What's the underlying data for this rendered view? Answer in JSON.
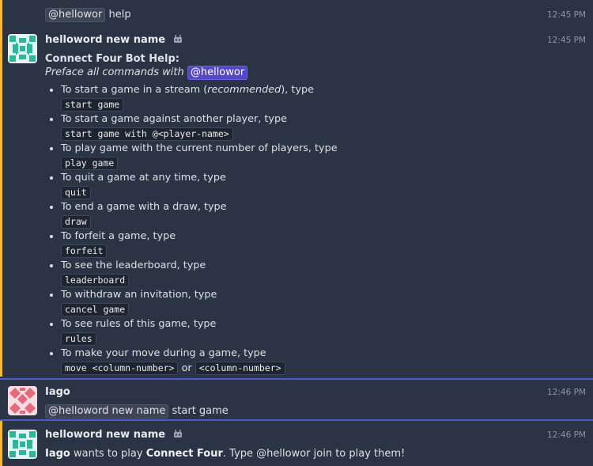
{
  "messages": {
    "m0": {
      "mention": "@hellowor",
      "text": "help",
      "time": "12:45 PM"
    },
    "m1": {
      "sender": "helloword new name",
      "time": "12:45 PM",
      "help_title": "Connect Four Bot Help:",
      "preface": "Preface all commands with",
      "preface_mention": "@hellowor",
      "items": [
        {
          "pre": "To start a game in a stream (",
          "em": "recommended",
          "post": "), type",
          "code": "start game"
        },
        {
          "pre": "To start a game against another player, type",
          "code": "start game with @<player-name>"
        },
        {
          "pre": "To play game with the current number of players, type",
          "code": "play game"
        },
        {
          "pre": "To quit a game at any time, type",
          "code": "quit"
        },
        {
          "pre": "To end a game with a draw, type",
          "code": "draw"
        },
        {
          "pre": "To forfeit a game, type",
          "code": "forfeit"
        },
        {
          "pre": "To see the leaderboard, type",
          "code": "leaderboard"
        },
        {
          "pre": "To withdraw an invitation, type",
          "code": "cancel game"
        },
        {
          "pre": "To see rules of this game, type",
          "code": "rules"
        },
        {
          "pre": "To make your move during a game, type",
          "code": "move <column-number>",
          "mid": "or",
          "code2": "<column-number>"
        }
      ]
    },
    "m2": {
      "sender": "Iago",
      "time": "12:46 PM",
      "mention": "@helloword new name",
      "text": "start game"
    },
    "m3": {
      "sender": "helloword new name",
      "time": "12:46 PM",
      "actor": "Iago",
      "t1": "wants to play",
      "game": "Connect Four",
      "t2": ". Type",
      "mention": "@hellowor",
      "t3": "join to play them!"
    }
  },
  "colors": {
    "background": "#2b3444",
    "bot_bar": "#f2b93b",
    "divider": "#4b5ec0",
    "mention_self": "#5548c8",
    "bot_avatar": "#2fb59a",
    "user_avatar": "#e5697a"
  },
  "icons": {
    "bot": "robot-icon"
  }
}
